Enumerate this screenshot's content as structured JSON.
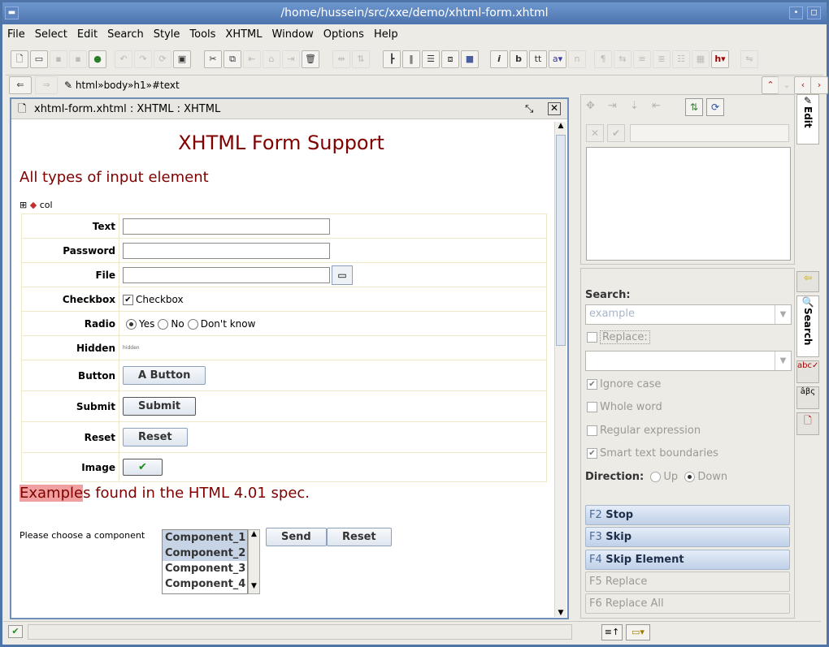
{
  "window": {
    "title": "/home/hussein/src/xxe/demo/xhtml-form.xhtml"
  },
  "menu": [
    "File",
    "Select",
    "Edit",
    "Search",
    "Style",
    "Tools",
    "XHTML",
    "Window",
    "Options",
    "Help"
  ],
  "toolbar": {
    "italic": "i",
    "bold": "b",
    "tt": "tt",
    "heading": "h"
  },
  "path": {
    "text": "html»body»h1»#text"
  },
  "document": {
    "tab_title": "xhtml-form.xhtml : XHTML : XHTML",
    "heading": "XHTML Form Support",
    "section1": "All types of input element",
    "col_label": "col",
    "rows": [
      {
        "label": "Text"
      },
      {
        "label": "Password"
      },
      {
        "label": "File"
      },
      {
        "label": "Checkbox",
        "value": "Checkbox",
        "checked": true
      },
      {
        "label": "Radio",
        "options": [
          "Yes",
          "No",
          "Don't know"
        ],
        "selected": "Yes"
      },
      {
        "label": "Hidden",
        "value": "hidden"
      },
      {
        "label": "Button",
        "value": "A Button"
      },
      {
        "label": "Submit",
        "value": "Submit"
      },
      {
        "label": "Reset",
        "value": "Reset"
      },
      {
        "label": "Image"
      }
    ],
    "section2_highlight": "Example",
    "section2_rest": "s found in the HTML 4.01 spec.",
    "choose_label": "Please choose a component",
    "components": [
      "Component_1",
      "Component_2",
      "Component_3",
      "Component_4"
    ],
    "send_label": "Send",
    "reset_label": "Reset"
  },
  "side": {
    "tabs": {
      "edit": "Edit",
      "search": "Search"
    },
    "search": {
      "label": "Search:",
      "value": "example",
      "replace_label": "Replace:",
      "ignore_case": "Ignore case",
      "whole_word": "Whole word",
      "regex": "Regular expression",
      "smart": "Smart text boundaries",
      "direction_label": "Direction:",
      "up": "Up",
      "down": "Down"
    },
    "actions": [
      {
        "key": "F2",
        "label": "Stop",
        "enabled": true
      },
      {
        "key": "F3",
        "label": "Skip",
        "enabled": true
      },
      {
        "key": "F4",
        "label": "Skip Element",
        "enabled": true
      },
      {
        "key": "F5",
        "label": "Replace",
        "enabled": false
      },
      {
        "key": "F6",
        "label": "Replace All",
        "enabled": false
      }
    ]
  },
  "colors": {
    "heading": "#800000",
    "title_bar": "#5a82be",
    "highlight": "#f0a0a0"
  }
}
